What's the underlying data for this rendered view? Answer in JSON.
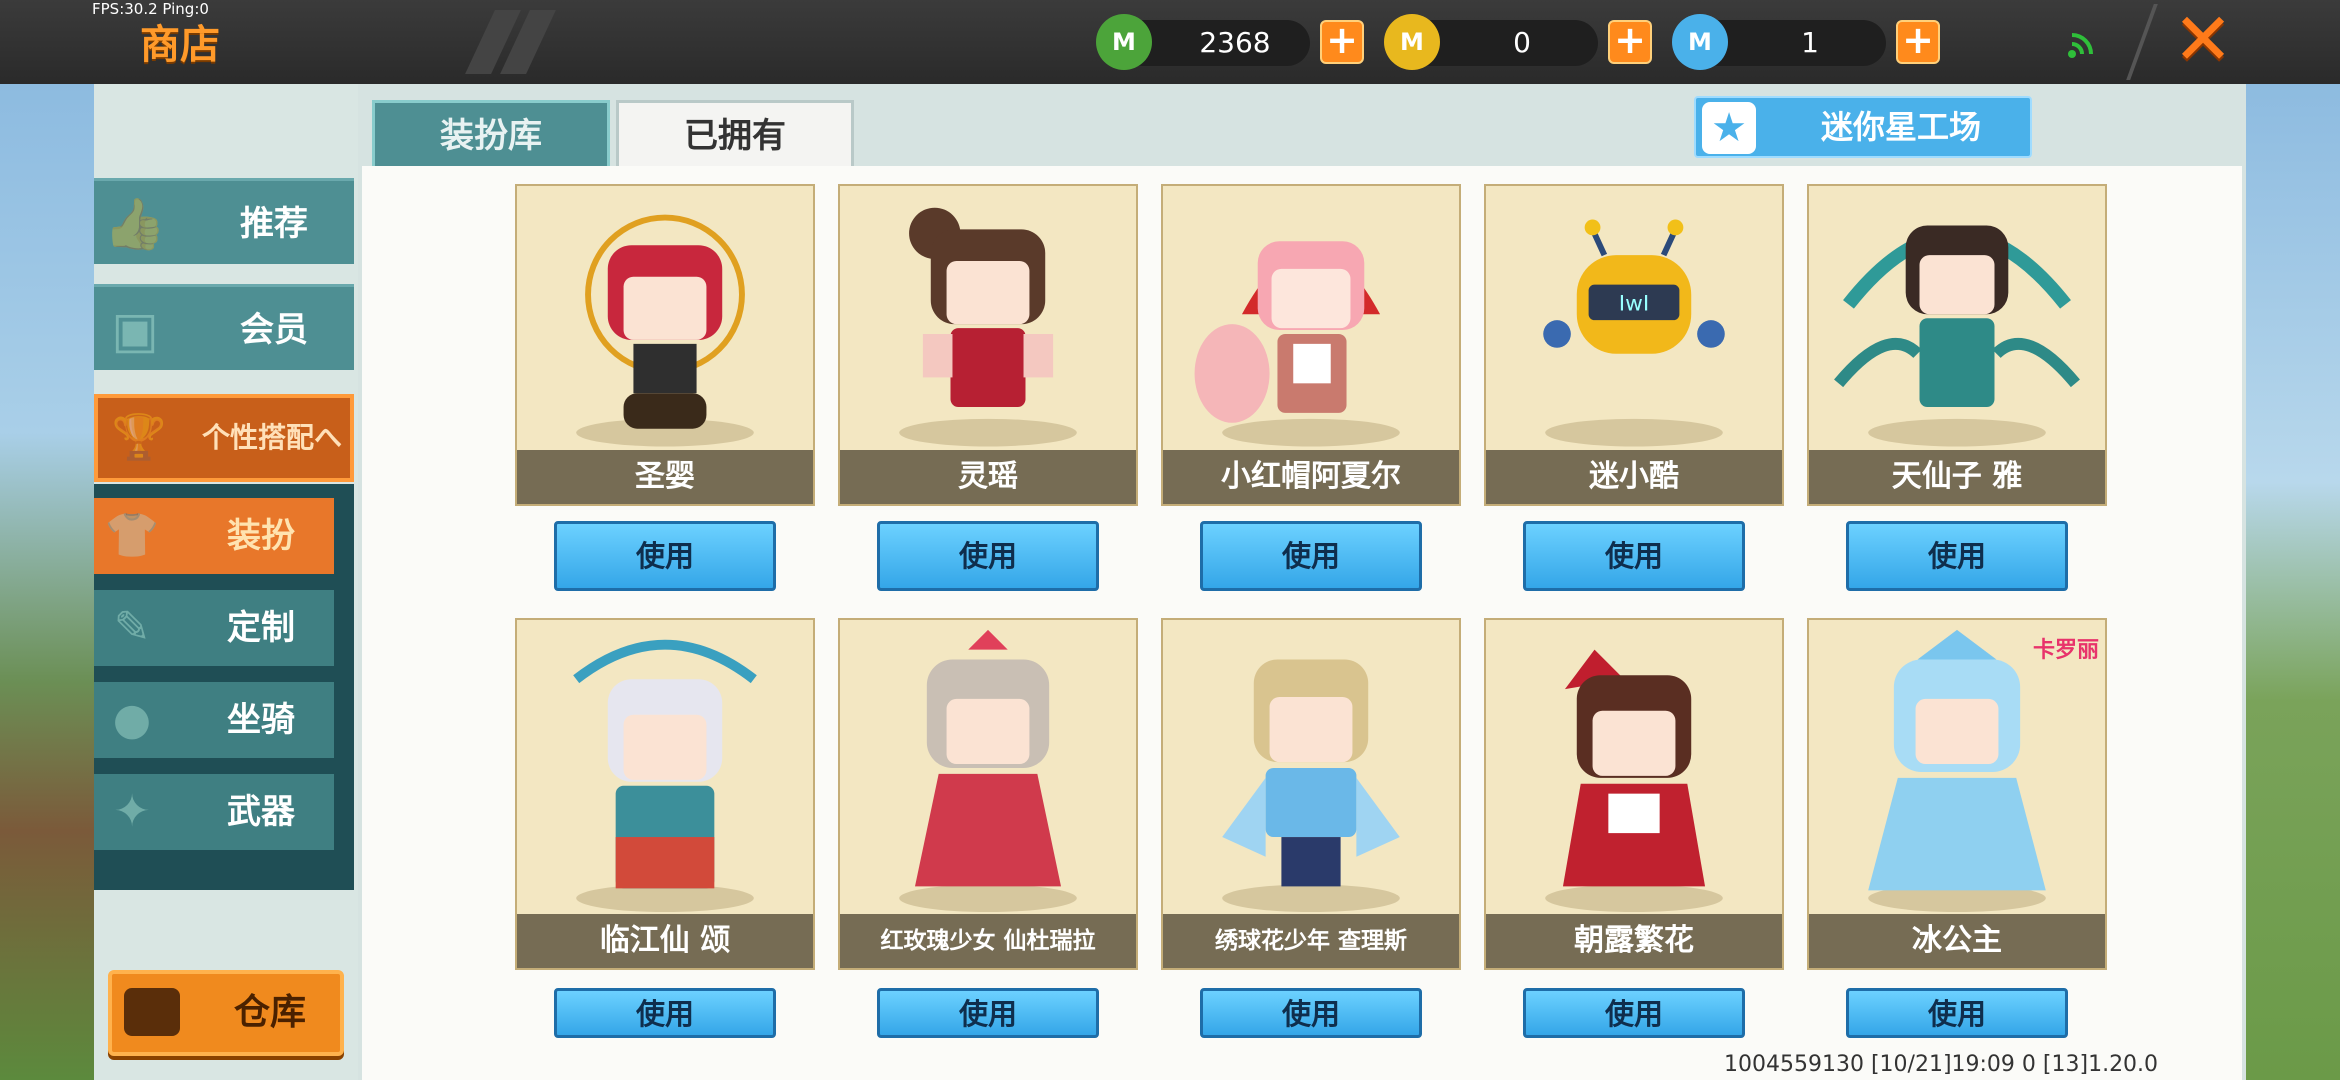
{
  "hud": {
    "fps": "FPS:30.2  Ping:0",
    "title": "商店",
    "currencies": [
      {
        "icon": "mini-bean-icon",
        "value": "2368",
        "color": "#4ca43a"
      },
      {
        "icon": "mini-coin-icon",
        "value": "0",
        "color": "#e8b81e"
      },
      {
        "icon": "mini-star-icon",
        "value": "1",
        "color": "#4ab1ea"
      }
    ],
    "plus": "+",
    "close": "✕"
  },
  "sidebar": {
    "items": [
      {
        "label": "推荐",
        "icon": "thumbs-up-icon"
      },
      {
        "label": "会员",
        "icon": "vip-card-icon"
      },
      {
        "label": "个性搭配へ",
        "icon": "trophy-icon"
      }
    ],
    "sub_items": [
      {
        "label": "装扮",
        "icon": "shirt-icon"
      },
      {
        "label": "定制",
        "icon": "pencil-icon"
      },
      {
        "label": "坐骑",
        "icon": "mount-icon"
      },
      {
        "label": "武器",
        "icon": "pistol-icon"
      }
    ],
    "warehouse": "仓库"
  },
  "tabs": [
    "装扮库",
    "已拥有"
  ],
  "studio_button": "迷你星工场",
  "row1": [
    {
      "name": "圣婴",
      "action": "使用"
    },
    {
      "name": "灵瑶",
      "action": "使用"
    },
    {
      "name": "小红帽阿夏尔",
      "action": "使用"
    },
    {
      "name": "迷小酷",
      "action": "使用"
    },
    {
      "name": "天仙子 雅",
      "action": "使用"
    }
  ],
  "row2": [
    {
      "name": "临江仙 颂",
      "action": "使用"
    },
    {
      "name": "红玫瑰少女 仙杜瑞拉",
      "action": "使用"
    },
    {
      "name": "绣球花少年 查理斯",
      "action": "使用"
    },
    {
      "name": "朝露繁花",
      "action": "使用"
    },
    {
      "name": "冰公主",
      "action": "使用",
      "badge": "卡罗丽"
    }
  ],
  "footer": "1004559130   [10/21]19:09 0   [13]1.20.0"
}
